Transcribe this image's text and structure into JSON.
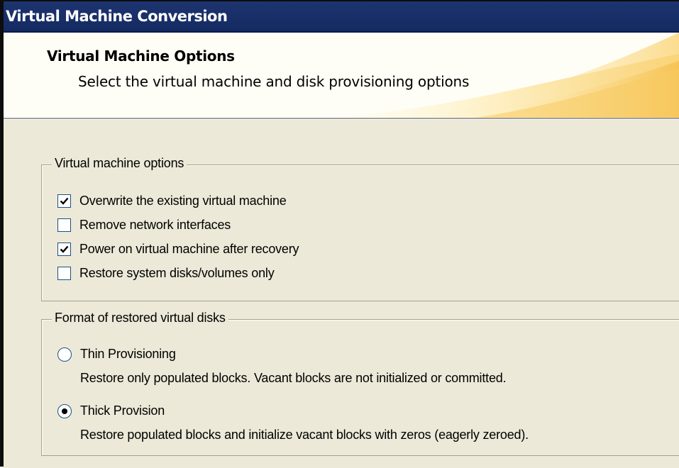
{
  "window": {
    "title": "Virtual Machine Conversion"
  },
  "header": {
    "title": "Virtual Machine Options",
    "subtitle": "Select the virtual machine and disk provisioning options"
  },
  "vm_options": {
    "legend": "Virtual machine options",
    "items": [
      {
        "label": "Overwrite the existing virtual machine",
        "checked": true
      },
      {
        "label": "Remove network interfaces",
        "checked": false
      },
      {
        "label": "Power on virtual machine after recovery",
        "checked": true
      },
      {
        "label": "Restore system disks/volumes only",
        "checked": false
      }
    ]
  },
  "disk_format": {
    "legend": "Format of restored virtual disks",
    "options": [
      {
        "label": "Thin Provisioning",
        "selected": false,
        "description": "Restore only populated blocks. Vacant blocks are not initialized or committed."
      },
      {
        "label": "Thick Provision",
        "selected": true,
        "description": "Restore populated blocks and initialize vacant blocks with zeros (eagerly zeroed)."
      }
    ]
  },
  "colors": {
    "title_bar": "#1d3470",
    "banner_bg": "#fffef6",
    "banner_accent": "#f5c95a",
    "dialog_bg": "#ece9d8",
    "control_border": "#1c5180"
  }
}
